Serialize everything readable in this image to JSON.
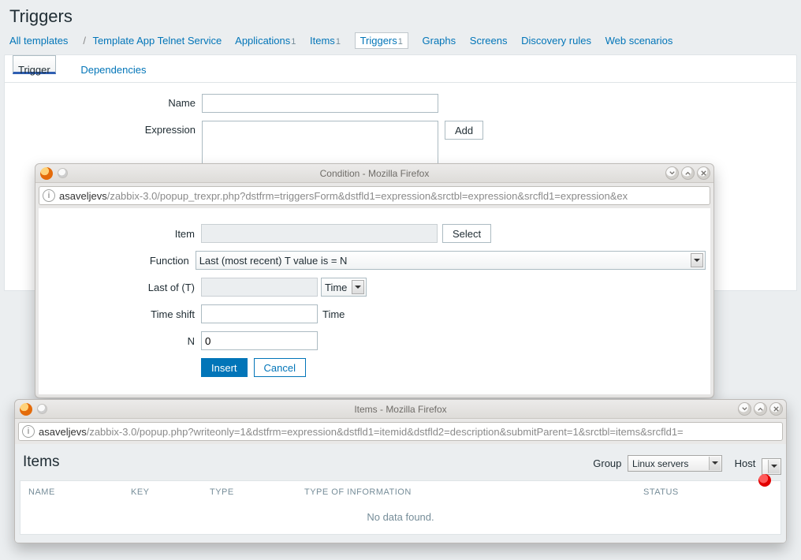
{
  "page": {
    "title": "Triggers"
  },
  "crumbs": {
    "all_templates": "All templates",
    "template_name": "Template App Telnet Service",
    "applications": {
      "label": "Applications",
      "count": "1"
    },
    "items": {
      "label": "Items",
      "count": "1"
    },
    "triggers": {
      "label": "Triggers",
      "count": "1"
    },
    "graphs": "Graphs",
    "screens": "Screens",
    "discovery": "Discovery rules",
    "web": "Web scenarios"
  },
  "tabs": {
    "trigger": "Trigger",
    "dependencies": "Dependencies"
  },
  "form": {
    "name_label": "Name",
    "name_value": "",
    "expr_label": "Expression",
    "expr_value": "",
    "add_btn": "Add"
  },
  "cond_popup": {
    "win_title": "Condition - Mozilla Firefox",
    "url_host": "asaveljevs",
    "url_path": "/zabbix-3.0/popup_trexpr.php?dstfrm=triggersForm&dstfld1=expression&srctbl=expression&srcfld1=expression&ex",
    "item_label": "Item",
    "item_value": "",
    "select_btn": "Select",
    "func_label": "Function",
    "func_value": "Last (most recent) T value is = N",
    "lastof_label": "Last of (T)",
    "lastof_value": "",
    "lastof_unit": "Time",
    "timeshift_label": "Time shift",
    "timeshift_value": "",
    "timeshift_unit": "Time",
    "n_label": "N",
    "n_value": "0",
    "insert_btn": "Insert",
    "cancel_btn": "Cancel"
  },
  "items_popup": {
    "win_title": "Items - Mozilla Firefox",
    "url_host": "asaveljevs",
    "url_path": "/zabbix-3.0/popup.php?writeonly=1&dstfrm=expression&dstfld1=itemid&dstfld2=description&submitParent=1&srctbl=items&srcfld1=",
    "heading": "Items",
    "group_label": "Group",
    "group_value": "Linux servers",
    "host_label": "Host",
    "host_value": "",
    "cols": {
      "name": "Name",
      "key": "Key",
      "type": "Type",
      "toi": "Type of information",
      "status": "Status"
    },
    "nodata": "No data found."
  }
}
